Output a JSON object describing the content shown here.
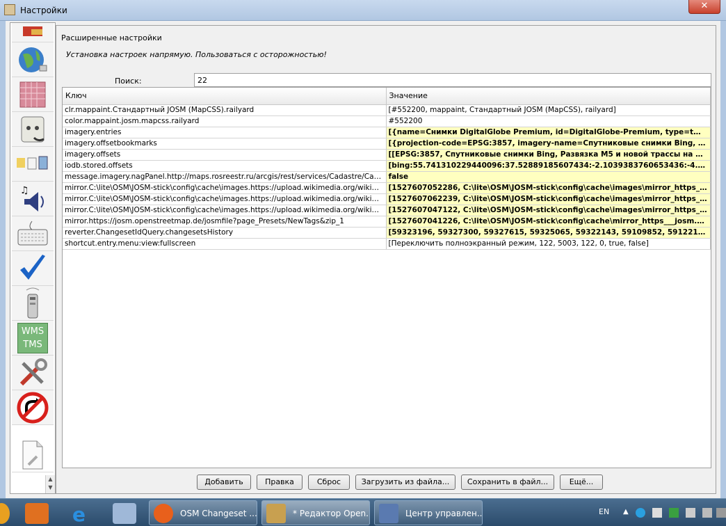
{
  "window": {
    "title": "Настройки",
    "close_glyph": "✕"
  },
  "sidebar": {
    "items": [
      {
        "icon": "map-paint-icon"
      },
      {
        "icon": "globe-icon"
      },
      {
        "icon": "projection-grid-icon"
      },
      {
        "icon": "plugin-socket-icon"
      },
      {
        "icon": "toolbar-icon"
      },
      {
        "icon": "audio-icon"
      },
      {
        "icon": "keyboard-icon"
      },
      {
        "icon": "validator-check-icon"
      },
      {
        "icon": "remote-control-icon"
      },
      {
        "icon": "wms-tms-icon",
        "text_top": "WMS",
        "text_bottom": "TMS"
      },
      {
        "icon": "tools-icon"
      },
      {
        "icon": "no-turn-icon"
      },
      {
        "icon": "advanced-settings-icon"
      }
    ]
  },
  "panel": {
    "section_title": "Расширенные настройки",
    "warning": "Установка настроек напрямую. Пользоваться с осторожностью!",
    "search_label": "Поиск:",
    "search_value": "22"
  },
  "table": {
    "headers": {
      "key": "Ключ",
      "value": "Значение"
    },
    "rows": [
      {
        "key": "clr.mappaint.Стандартный JOSM (MapCSS).railyard",
        "value": "[#552200, mappaint, Стандартный JOSM (MapCSS), railyard]",
        "changed": false
      },
      {
        "key": "color.mappaint.josm.mapcss.railyard",
        "value": "#552200",
        "changed": false
      },
      {
        "key": "imagery.entries",
        "value": "[{name=Снимки DigitalGlobe Premium, id=DigitalGlobe-Premium, type=tms, url...",
        "changed": true
      },
      {
        "key": "imagery.offsetbookmarks",
        "value": "[{projection-code=EPSG:3857, imagery-name=Спутниковые снимки Bing, nam...",
        "changed": true
      },
      {
        "key": "imagery.offsets",
        "value": "[[EPSG:3857, Спутниковые снимки Bing, Развязка М5 и новой трассы на Жуко...",
        "changed": true
      },
      {
        "key": "iodb.stored.offsets",
        "value": "[bing:55.741310229440096:37.52889185607434:-2.1039383760653436:-4.1707...",
        "changed": true
      },
      {
        "key": "message.imagery.nagPanel.http://maps.rosreestr.ru/arcgis/rest/services/Cadastre/Cadastre...",
        "value": "false",
        "changed": true
      },
      {
        "key": "mirror.C:\\lite\\OSM\\JOSM-stick\\config\\cache\\images.https://upload.wikimedia.org/wikipedia/co...",
        "value": "[1527607052286, C:\\lite\\OSM\\JOSM-stick\\config\\cache\\images\\mirror_https_...",
        "changed": true
      },
      {
        "key": "mirror.C:\\lite\\OSM\\JOSM-stick\\config\\cache\\images.https://upload.wikimedia.org/wikipedia/co...",
        "value": "[1527607062239, C:\\lite\\OSM\\JOSM-stick\\config\\cache\\images\\mirror_https_...",
        "changed": true
      },
      {
        "key": "mirror.C:\\lite\\OSM\\JOSM-stick\\config\\cache\\images.https://upload.wikimedia.org/wikipedia/ru...",
        "value": "[1527607047122, C:\\lite\\OSM\\JOSM-stick\\config\\cache\\images\\mirror_https_...",
        "changed": true
      },
      {
        "key": "mirror.https://josm.openstreetmap.de/josmfile?page_Presets/NewTags&zip_1",
        "value": "[1527607041226, C:\\lite\\OSM\\JOSM-stick\\config\\cache\\mirror_https___josm.o...",
        "changed": true
      },
      {
        "key": "reverter.ChangesetIdQuery.changesetsHistory",
        "value": "[59323196, 59327300, 59327615, 59325065, 59322143, 59109852, 59122112, 41...",
        "changed": true
      },
      {
        "key": "shortcut.entry.menu:view:fullscreen",
        "value": "[Переключить полноэкранный режим, 122, 5003, 122, 0, true, false]",
        "changed": false
      }
    ]
  },
  "buttons": {
    "add": "Добавить",
    "edit": "Правка",
    "reset": "Сброс",
    "load": "Загрузить из файла...",
    "save": "Сохранить в файл...",
    "more": "Ещё..."
  },
  "taskbar": {
    "tasks": [
      {
        "label": "OSM Changeset ...",
        "icon": "firefox-icon"
      },
      {
        "label": "* Редактор Open...",
        "icon": "josm-icon"
      },
      {
        "label": "Центр управлен...",
        "icon": "control-center-icon"
      }
    ],
    "lang": "EN"
  }
}
